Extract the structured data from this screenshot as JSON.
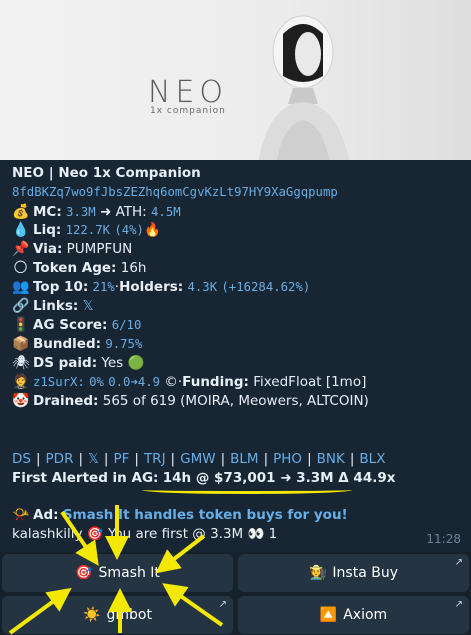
{
  "hero": {
    "logo": "NEO",
    "subtitle": "1x companion"
  },
  "message": {
    "title": "NEO | Neo 1x Companion",
    "address": "8fdBKZq7wo9fJbsZEZhq6omCgvKzLt97HY9XaGgqpump",
    "mc": {
      "label": "MC:",
      "value": "3.3M",
      "arrow": "➜",
      "ath_label": "ATH:",
      "ath_value": "4.5M"
    },
    "liq": {
      "label": "Liq:",
      "value": "122.7K",
      "pct": "(4%)",
      "icon": "🔥"
    },
    "via": {
      "label": "Via:",
      "value": "PUMPFUN"
    },
    "token_age": {
      "label": "Token Age:",
      "value": "16h"
    },
    "top10": {
      "label": "Top 10:",
      "value": "21%",
      "holders_label": "Holders:",
      "holders_value": "4.3K",
      "holders_delta": "(+16284.62%)"
    },
    "links": {
      "label": "Links:",
      "value": "𝕏"
    },
    "ag_score": {
      "label": "AG Score:",
      "value": "6/10"
    },
    "bundled": {
      "label": "Bundled:",
      "value": "9.75%"
    },
    "ds_paid": {
      "label": "DS paid:",
      "value": "Yes",
      "icon": "🟢"
    },
    "dev": {
      "name": "z1SurX:",
      "pct": "0%",
      "range": "0.0➜4.9",
      "icon": "©",
      "funding_label": "Funding:",
      "funding_value": "FixedFloat [1mo]"
    },
    "drained": {
      "label": "Drained:",
      "value": "565 of 619 (MOIRA, Meowers, ALTCOIN)"
    },
    "nav_links": [
      "DS",
      "PDR",
      "𝕏",
      "PF",
      "TRJ",
      "GMW",
      "BLM",
      "PHO",
      "BNK",
      "BLX"
    ],
    "first_alerted": {
      "label": "First Alerted in AG:",
      "value": "14h @ $73,001 ➜ 3.3M Δ 44.9x"
    },
    "ad": {
      "icon": "📯",
      "label": "Ad:",
      "text": "Smash It handles token buys for you!"
    },
    "notice": {
      "user": "kalashkilly",
      "icon": "🎯",
      "text": "You are first @ 3.3M",
      "eyes": "👀",
      "count": "1"
    },
    "time": "11:28"
  },
  "buttons": [
    {
      "icon": "🎯",
      "label": "Smash It"
    },
    {
      "icon": "🧑‍🌾",
      "label": "Insta Buy"
    },
    {
      "icon": "☀️",
      "label": "gmbot"
    },
    {
      "icon": "🔼",
      "label": "Axiom"
    }
  ],
  "colors": {
    "background": "#17212b",
    "link": "#67aee6",
    "button": "#243443",
    "highlight": "#f4e800"
  }
}
